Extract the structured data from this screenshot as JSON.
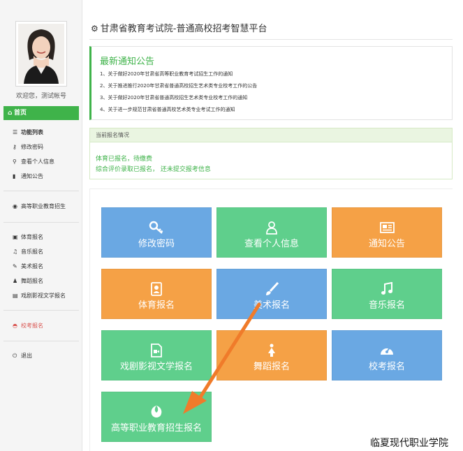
{
  "header": {
    "title": "甘肃省教育考试院-普通高校招考智慧平台",
    "icon": "gear-icon"
  },
  "sidebar": {
    "welcome": "欢迎您，测试帐号",
    "home": "首页",
    "section_features": "功能列表",
    "features": [
      "修改密码",
      "查看个人信息",
      "通知公告"
    ],
    "vocational": "高等职业教育招生",
    "signups": [
      "体育报名",
      "音乐报名",
      "美术报名",
      "舞蹈报名",
      "戏剧影视文学报名"
    ],
    "school_exam": "校考报名",
    "logout": "退出"
  },
  "notice": {
    "title": "最新通知公告",
    "items": [
      "1、关于做好2020年甘肃省高等职业教育考试招生工作的通知",
      "2、关于推进推行2020年甘肃省普通高校招生艺术类专业校考工作的公告",
      "3、关于做好2020年甘肃省普通高校招生艺术类专业校考工作的通知",
      "4、关于进一步规范甘肃省普通高校艺术类专业考试工作的通知"
    ]
  },
  "status": {
    "heading": "当前报名情况",
    "lines": [
      "体育已报名，待缴费",
      "综合评价录取已报名， 还未提交报考信息"
    ]
  },
  "tiles": [
    {
      "label": "修改密码",
      "icon": "key-icon",
      "color": "blue"
    },
    {
      "label": "查看个人信息",
      "icon": "user-icon",
      "color": "green"
    },
    {
      "label": "通知公告",
      "icon": "newspaper-icon",
      "color": "orange"
    },
    {
      "label": "体育报名",
      "icon": "portrait-icon",
      "color": "orange"
    },
    {
      "label": "美术报名",
      "icon": "paintbrush-icon",
      "color": "blue"
    },
    {
      "label": "音乐报名",
      "icon": "music-note-icon",
      "color": "green"
    },
    {
      "label": "戏剧影视文学报名",
      "icon": "video-file-icon",
      "color": "green"
    },
    {
      "label": "舞蹈报名",
      "icon": "dancer-icon",
      "color": "orange"
    },
    {
      "label": "校考报名",
      "icon": "dashboard-icon",
      "color": "blue"
    },
    {
      "label": "高等职业教育招生报名",
      "icon": "rebel-icon",
      "color": "green"
    }
  ],
  "watermark": "临夏现代职业学院",
  "colors": {
    "green": "#3fb34a",
    "tile_blue": "#6aa8e3",
    "tile_green": "#5fcf8c",
    "tile_orange": "#f5a146",
    "arrow": "#f07b2a"
  }
}
